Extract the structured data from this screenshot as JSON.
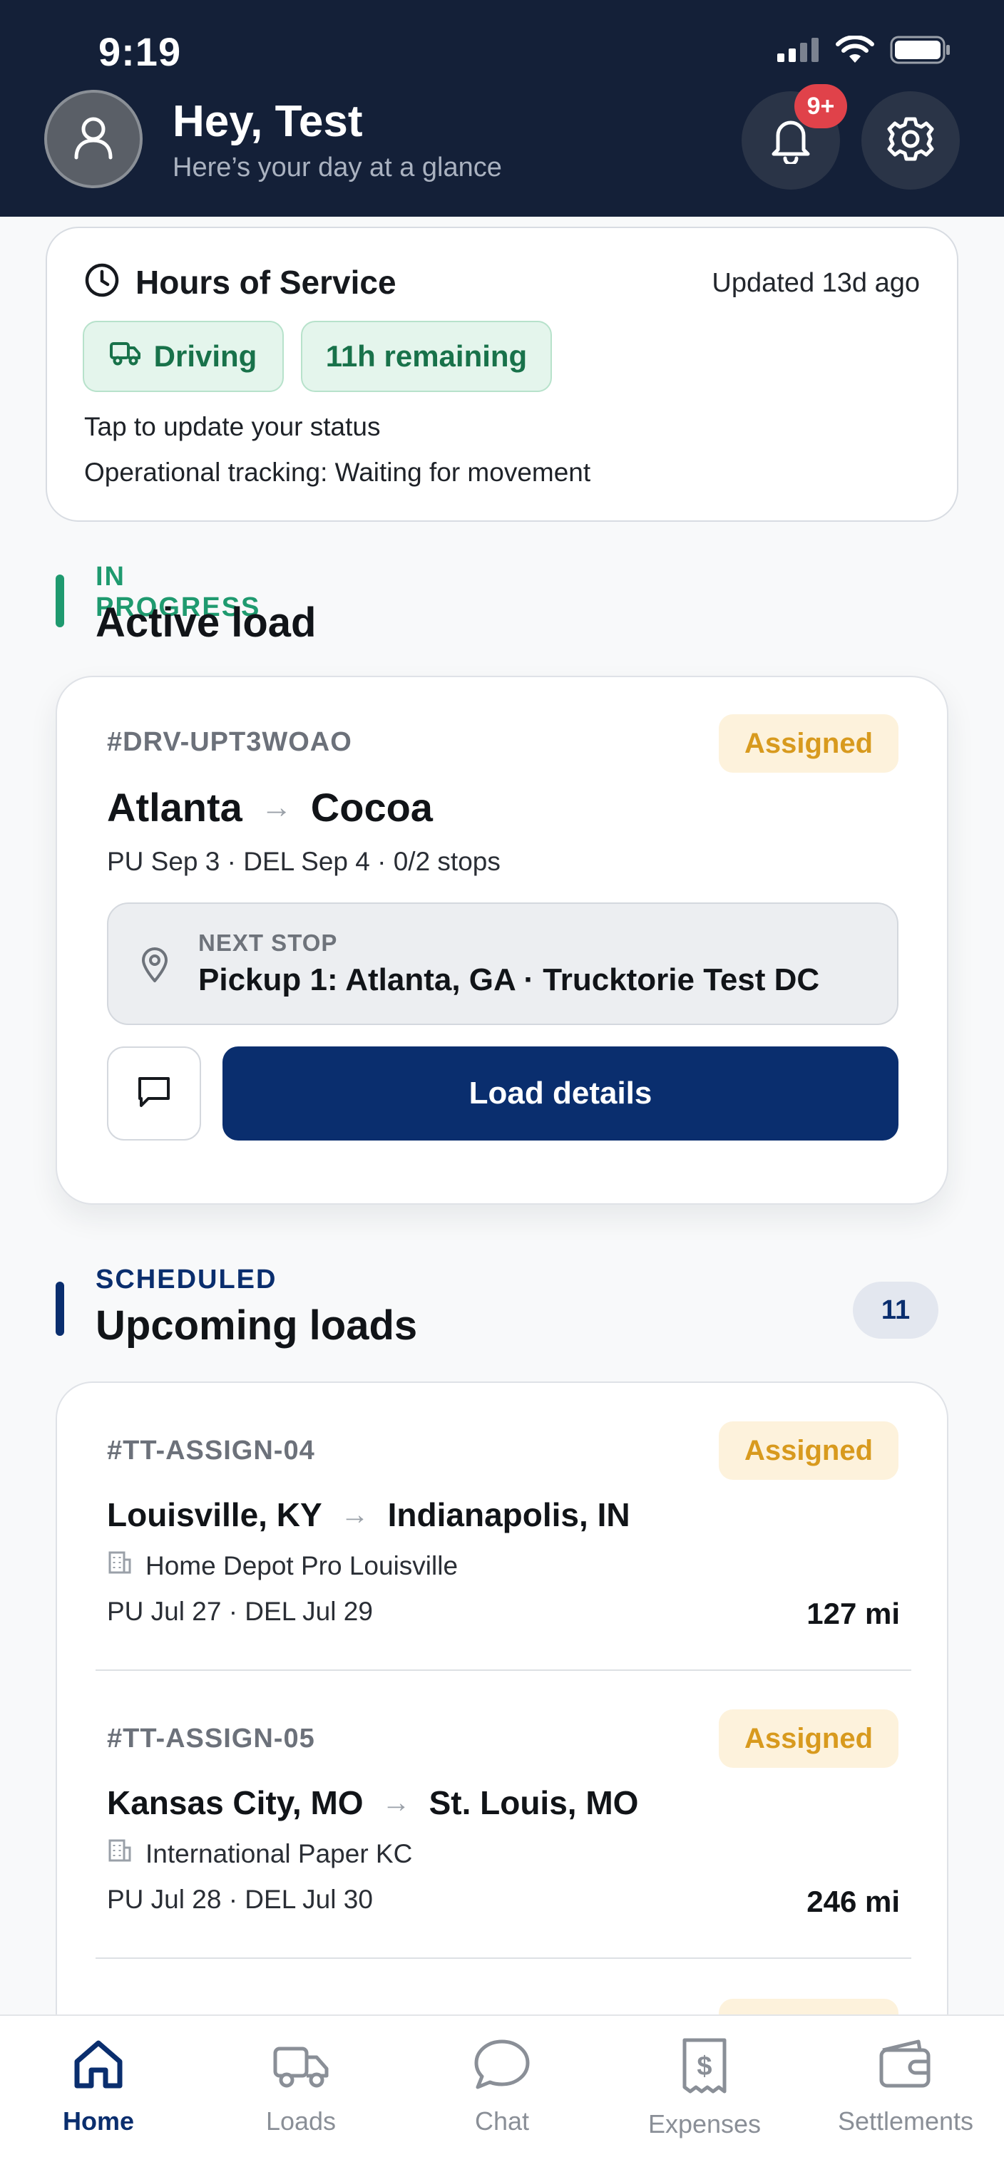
{
  "status_bar": {
    "time": "9:19"
  },
  "header": {
    "greeting": "Hey, Test",
    "subtitle": "Here’s your day at a glance",
    "notification_badge": "9+"
  },
  "hos": {
    "title": "Hours of Service",
    "updated": "Updated 13d ago",
    "status_pill": "Driving",
    "remaining_pill": "11h remaining",
    "line1": "Tap to update your status",
    "line2": "Operational tracking: Waiting for movement"
  },
  "active_section": {
    "eyebrow": "IN PROGRESS",
    "title": "Active load",
    "accent": "#1f9a6f"
  },
  "active_load": {
    "id": "#DRV-UPT3WOAO",
    "status": "Assigned",
    "origin": "Atlanta",
    "destination": "Cocoa",
    "arrow": "→",
    "summary": "PU Sep 3 · DEL Sep 4 · 0/2 stops",
    "next_stop_label": "NEXT STOP",
    "next_stop_value": "Pickup 1: Atlanta, GA · Trucktorie Test DC",
    "details_button": "Load details"
  },
  "upcoming_section": {
    "eyebrow": "SCHEDULED",
    "title": "Upcoming loads",
    "count": "11",
    "accent": "#0a2e6e"
  },
  "upcoming_loads": [
    {
      "id": "#TT-ASSIGN-04",
      "status": "Assigned",
      "origin": "Louisville, KY",
      "destination": "Indianapolis, IN",
      "arrow": "→",
      "facility": "Home Depot Pro Louisville",
      "dates": "PU Jul 27 · DEL Jul 29",
      "miles": "127 mi"
    },
    {
      "id": "#TT-ASSIGN-05",
      "status": "Assigned",
      "origin": "Kansas City, MO",
      "destination": "St. Louis, MO",
      "arrow": "→",
      "facility": "International Paper KC",
      "dates": "PU Jul 28 · DEL Jul 30",
      "miles": "246 mi"
    }
  ],
  "tabs": [
    {
      "label": "Home",
      "icon": "home-icon",
      "active": true
    },
    {
      "label": "Loads",
      "icon": "truck-icon",
      "active": false
    },
    {
      "label": "Chat",
      "icon": "chat-icon",
      "active": false
    },
    {
      "label": "Expenses",
      "icon": "receipt-icon",
      "active": false
    },
    {
      "label": "Settlements",
      "icon": "wallet-icon",
      "active": false
    }
  ]
}
